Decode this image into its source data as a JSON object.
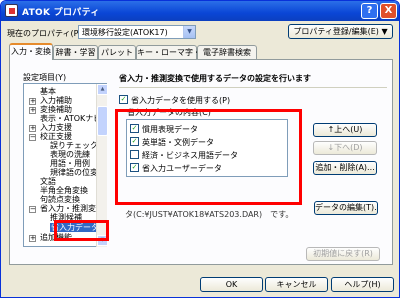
{
  "title": "ATOK プロパティ",
  "title_buttons": {
    "help": "?",
    "close": "X"
  },
  "current_property_label": "現在のプロパティ(P)",
  "current_property_value": "環境移行設定(ATOK17)",
  "register_edit_button": "プロパティ登録/編集(E) ▼",
  "tabs": [
    "入力・変換",
    "辞書・学習",
    "パレット",
    "キー・ローマ字・色",
    "電子辞書検索"
  ],
  "tree": {
    "label": "設定項目(Y)",
    "items": [
      "基本",
      "入力補助",
      "変換補助",
      "表示・ATOKナビ",
      "入力支援",
      "校正支援",
      "誤りチェック",
      "表現の洗練",
      "用語・用例",
      "規律語の位変",
      "文語",
      "半角全角変換",
      "句読点変換",
      "省入力・推測変換",
      "推測候補",
      "省入力データ",
      "追加機能"
    ]
  },
  "heading": "省入力・推測変換で使用するデータの設定を行います",
  "use_data_label": "省入力データを使用する(P)",
  "content_label": "省入力データの内容(C)",
  "list_items": [
    "慣用表現データ",
    "英単語・文例データ",
    "経済・ビジネス用語データ",
    "省入力ユーザーデータ"
  ],
  "list_checked": [
    true,
    true,
    false,
    true
  ],
  "buttons": {
    "up": "↑上へ(U)",
    "down": "↓下へ(D)",
    "add_delete": "追加・削除(A)...",
    "data_edit": "データの編集(T)...",
    "reset": "初期値に戻す(R)",
    "ok": "OK",
    "cancel": "キャンセル",
    "help": "ヘルプ(H)"
  },
  "description": "タ(C:¥JUST¥ATOK18¥ATS203.DAR)　です。",
  "colors": {
    "accent": "#ff0000",
    "selection": "#316ac5",
    "titlebar": "#0a46d6"
  }
}
